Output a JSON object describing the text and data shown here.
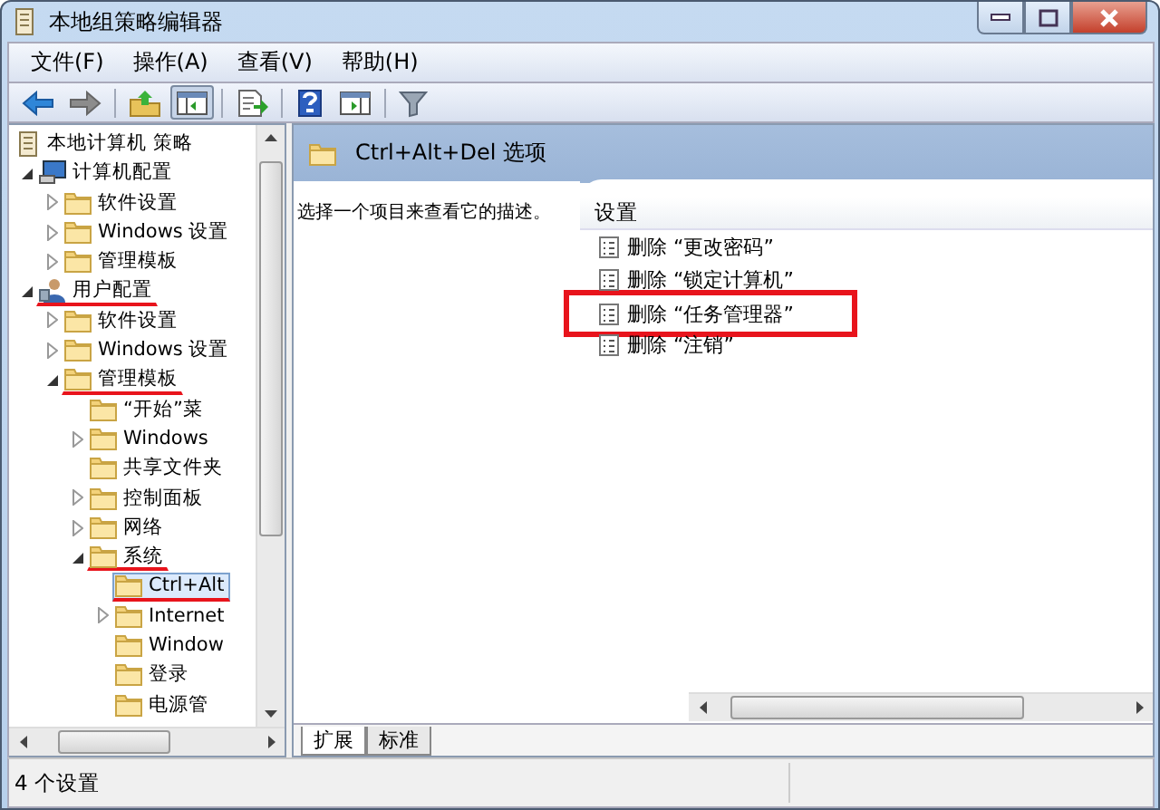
{
  "window": {
    "title": "本地组策略编辑器"
  },
  "menu": [
    "文件(F)",
    "操作(A)",
    "查看(V)",
    "帮助(H)"
  ],
  "toolbar": [
    {
      "kind": "back",
      "pressed": false
    },
    {
      "kind": "forward",
      "pressed": false
    },
    {
      "kind": "up",
      "pressed": false
    },
    {
      "kind": "tree",
      "pressed": true
    },
    {
      "kind": "export",
      "pressed": false
    },
    {
      "kind": "help",
      "pressed": false
    },
    {
      "kind": "pane",
      "pressed": false
    },
    {
      "kind": "filter",
      "pressed": false
    }
  ],
  "tree": {
    "label": "本地计算机 策略",
    "kind": "policy",
    "selected": false,
    "underlined": false,
    "children": [
      {
        "label": "计算机配置",
        "kind": "computer",
        "expanded": true,
        "selected": false,
        "underlined": false,
        "children": [
          {
            "label": "软件设置",
            "kind": "folder",
            "expanded": false,
            "selected": false,
            "underlined": false
          },
          {
            "label": "Windows 设置",
            "kind": "folder",
            "expanded": false,
            "selected": false,
            "underlined": false
          },
          {
            "label": "管理模板",
            "kind": "folder",
            "expanded": false,
            "selected": false,
            "underlined": false
          }
        ]
      },
      {
        "label": "用户配置",
        "kind": "user",
        "expanded": true,
        "selected": false,
        "underlined": true,
        "children": [
          {
            "label": "软件设置",
            "kind": "folder",
            "expanded": false,
            "selected": false,
            "underlined": false
          },
          {
            "label": "Windows 设置",
            "kind": "folder",
            "expanded": false,
            "selected": false,
            "underlined": false
          },
          {
            "label": "管理模板",
            "kind": "folder",
            "expanded": true,
            "selected": false,
            "underlined": true,
            "children": [
              {
                "label": "“开始”菜",
                "kind": "folder",
                "selected": false,
                "underlined": false
              },
              {
                "label": "Windows",
                "kind": "folder",
                "expanded": false,
                "selected": false,
                "underlined": false
              },
              {
                "label": "共享文件夹",
                "kind": "folder",
                "selected": false,
                "underlined": false
              },
              {
                "label": "控制面板",
                "kind": "folder",
                "expanded": false,
                "selected": false,
                "underlined": false
              },
              {
                "label": "网络",
                "kind": "folder",
                "expanded": false,
                "selected": false,
                "underlined": false
              },
              {
                "label": "系统",
                "kind": "folder",
                "expanded": true,
                "selected": false,
                "underlined": true,
                "children": [
                  {
                    "label": "Ctrl+Alt",
                    "kind": "folder",
                    "selected": true,
                    "underlined": true
                  },
                  {
                    "label": "Internet",
                    "kind": "folder",
                    "expanded": false,
                    "selected": false,
                    "underlined": false
                  },
                  {
                    "label": "Window",
                    "kind": "folder",
                    "selected": false,
                    "underlined": false
                  },
                  {
                    "label": "登录",
                    "kind": "folder",
                    "selected": false,
                    "underlined": false
                  },
                  {
                    "label": "电源管",
                    "kind": "folder",
                    "selected": false,
                    "underlined": false
                  }
                ]
              }
            ]
          }
        ]
      }
    ]
  },
  "detail": {
    "title": "Ctrl+Alt+Del 选项",
    "description": "选择一个项目来查看它的描述。",
    "column": "设置",
    "items": [
      {
        "label": "删除 “更改密码”",
        "boxed": false
      },
      {
        "label": "删除 “锁定计算机”",
        "boxed": false
      },
      {
        "label": "删除 “任务管理器”",
        "boxed": true
      },
      {
        "label": "删除 “注销”",
        "boxed": false
      }
    ]
  },
  "view_tabs": [
    {
      "label": "扩展",
      "selected": true
    },
    {
      "label": "标准",
      "selected": false
    }
  ],
  "status_bar": "4 个设置"
}
